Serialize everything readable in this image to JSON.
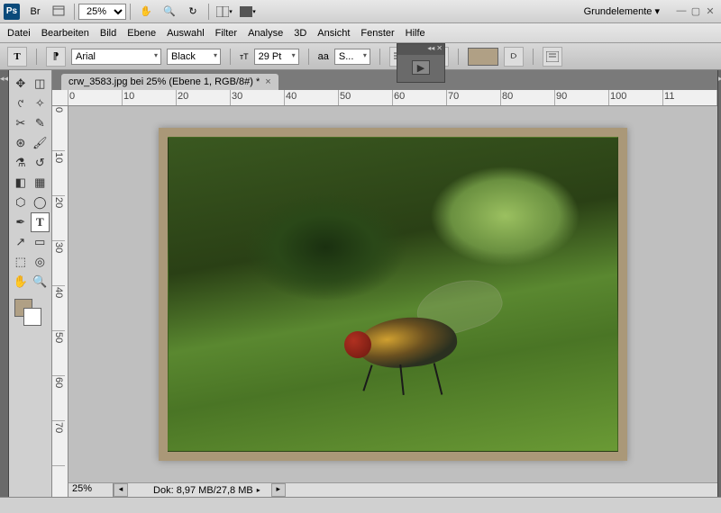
{
  "titlebar": {
    "zoom": "25%",
    "workspace": "Grundelemente ▾"
  },
  "menu": [
    "Datei",
    "Bearbeiten",
    "Bild",
    "Ebene",
    "Auswahl",
    "Filter",
    "Analyse",
    "3D",
    "Ansicht",
    "Fenster",
    "Hilfe"
  ],
  "options": {
    "font_family": "Arial",
    "font_style": "Black",
    "font_size": "29 Pt",
    "aa_label": "aa"
  },
  "doc_tab": {
    "title": "crw_3583.jpg bei 25% (Ebene 1, RGB/8#) *"
  },
  "ruler_h": [
    "0",
    "10",
    "20",
    "30",
    "40",
    "50",
    "60",
    "70",
    "80",
    "90",
    "100",
    "11"
  ],
  "ruler_v": [
    "0",
    "10",
    "20",
    "30",
    "40",
    "50",
    "60",
    "70"
  ],
  "status": {
    "zoom": "25%",
    "doc": "Dok: 8,97 MB/27,8 MB"
  }
}
